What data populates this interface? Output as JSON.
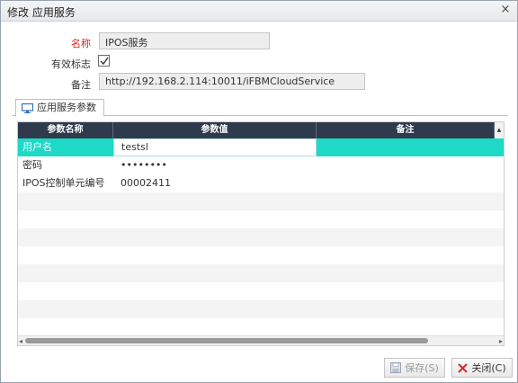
{
  "window": {
    "title": "修改 应用服务",
    "close_glyph": "×"
  },
  "form": {
    "name_label": "名称",
    "name_value": "IPOS服务",
    "valid_label": "有效标志",
    "valid_checked": true,
    "note_label": "备注",
    "note_value": "http://192.168.2.114:10011/iFBMCloudService"
  },
  "tab": {
    "label": "应用服务参数",
    "icon": "monitor-icon"
  },
  "grid": {
    "columns": [
      "参数名称",
      "参数值",
      "备注"
    ],
    "rows": [
      {
        "name": "用户名",
        "value": "testsl",
        "note": ""
      },
      {
        "name": "密码",
        "value": "••••••••",
        "note": ""
      },
      {
        "name": "IPOS控制单元编号",
        "value": "00002411",
        "note": ""
      }
    ],
    "empty_rows": 8
  },
  "buttons": {
    "save_label": "保存(S)",
    "close_label": "关闭(C)"
  },
  "colors": {
    "header_bg": "#2f3b4c",
    "selected_row": "#1ed9c6",
    "required_label": "#e02020"
  }
}
